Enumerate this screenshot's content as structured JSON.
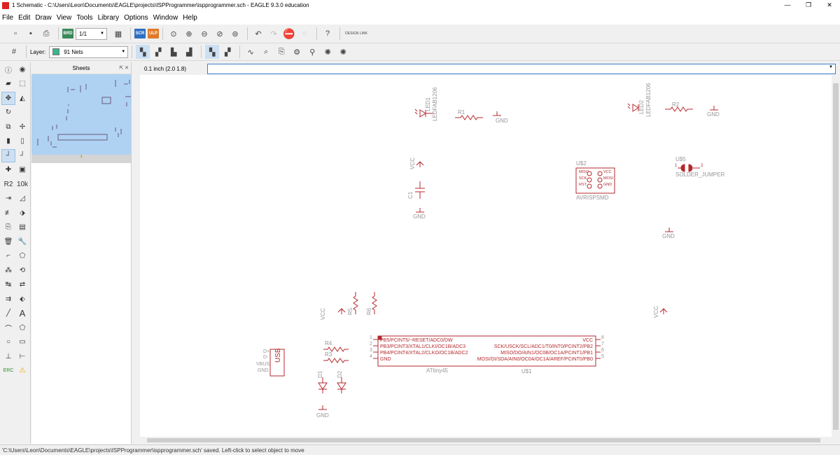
{
  "window": {
    "title": "1 Schematic - C:\\Users\\Leon\\Documents\\EAGLE\\projects\\ISPProgrammer\\ispprogrammer.sch - EAGLE 9.3.0 education",
    "minimize": "—",
    "restore": "❐",
    "close": "✕"
  },
  "menu": [
    "File",
    "Edit",
    "Draw",
    "View",
    "Tools",
    "Library",
    "Options",
    "Window",
    "Help"
  ],
  "toolbar": {
    "sheet_select": "1/1",
    "brd_label": "BRD",
    "sch_label": "SCR",
    "ulp_label": "ULP",
    "design_link": "DESIGN LINK"
  },
  "layer": {
    "label": "Layer:",
    "value": "91 Nets",
    "color": "#3cb48c"
  },
  "sheets_panel": {
    "title": "Sheets",
    "page_num": "1"
  },
  "coords": "0.1 inch (2.0 1.8)",
  "command_value": "",
  "status": "'C:\\Users\\Leon\\Documents\\EAGLE\\projects\\ISPProgrammer\\ispprogrammer.sch' saved. Left-click to select object to move",
  "colors": {
    "symbol": "#b4282d",
    "net_label": "#969696",
    "accent": "#3c7fd0"
  },
  "schematic": {
    "led1": {
      "name": "LED1",
      "value": "LEDFAB1206"
    },
    "r1": "R1",
    "gnd": "GND",
    "led2": {
      "name": "LED2",
      "value": "LEDFAB1206"
    },
    "r2": "R2",
    "vcc": "VCC",
    "c1": "C1",
    "isp": {
      "name": "U$2",
      "value": "AVRISPSMD",
      "pins": [
        "MISO",
        "SCK",
        "RST",
        "VCC",
        "MOSI",
        "GND"
      ]
    },
    "jumper": {
      "name": "U$5",
      "value": "SOLDER_JUMPER",
      "pins": [
        "1",
        "2"
      ]
    },
    "r5": "R5",
    "r6": "R6",
    "r3": "R3",
    "r4": "R4",
    "d1": "D1",
    "d2": "D2",
    "usb": {
      "label": "USB",
      "pins": [
        "D+",
        "D-",
        "VBUS",
        "GND"
      ]
    },
    "mcu": {
      "name": "U$1",
      "value": "ATtiny45",
      "left_pins": [
        {
          "num": "1",
          "label": "PB5/PCINT5/~RESET/ADC0/DW"
        },
        {
          "num": "2",
          "label": "PB3/PCINT3/XTAL1/CLKI/OC1B/ADC3"
        },
        {
          "num": "3",
          "label": "PB4/PCINT4/XTAL2/CLKO/OC1B/ADC2"
        },
        {
          "num": "4",
          "label": "GND"
        }
      ],
      "right_pins": [
        {
          "num": "8",
          "label": "VCC"
        },
        {
          "num": "7",
          "label": "SCK/USCK/SCL/ADC1/T0/INT0/PCINT2/PB2"
        },
        {
          "num": "6",
          "label": "MISO/DO/AIN1/OC0B/OC1A/PCINT1/PB1"
        },
        {
          "num": "5",
          "label": "MOSI/DI/SDA/AIN0/OC0A/OC1A/AREF/PCINT0/PB0"
        }
      ]
    }
  }
}
